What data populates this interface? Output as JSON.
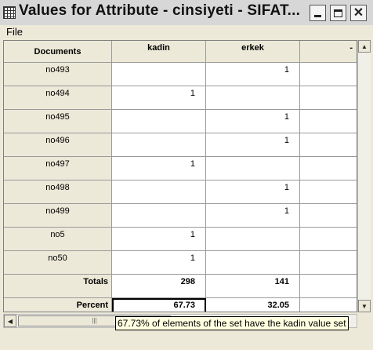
{
  "window": {
    "title": "Values for Attribute - cinsiyeti - SIFAT...",
    "icon": "grid-icon"
  },
  "menu": [
    "File"
  ],
  "table": {
    "corner_label": "Documents",
    "columns": [
      "kadin",
      "erkek",
      "-"
    ],
    "rows": [
      {
        "doc": "no493",
        "kadin": "",
        "erkek": "1"
      },
      {
        "doc": "no494",
        "kadin": "1",
        "erkek": ""
      },
      {
        "doc": "no495",
        "kadin": "",
        "erkek": "1"
      },
      {
        "doc": "no496",
        "kadin": "",
        "erkek": "1"
      },
      {
        "doc": "no497",
        "kadin": "1",
        "erkek": ""
      },
      {
        "doc": "no498",
        "kadin": "",
        "erkek": "1"
      },
      {
        "doc": "no499",
        "kadin": "",
        "erkek": "1"
      },
      {
        "doc": "no5",
        "kadin": "1",
        "erkek": ""
      },
      {
        "doc": "no50",
        "kadin": "1",
        "erkek": ""
      }
    ],
    "totals": {
      "label": "Totals",
      "kadin": "298",
      "erkek": "141"
    },
    "percent": {
      "label": "Percent",
      "kadin": "67.73",
      "erkek": "32.05"
    }
  },
  "tooltip": "67.73% of elements of the set have the kadin value set"
}
